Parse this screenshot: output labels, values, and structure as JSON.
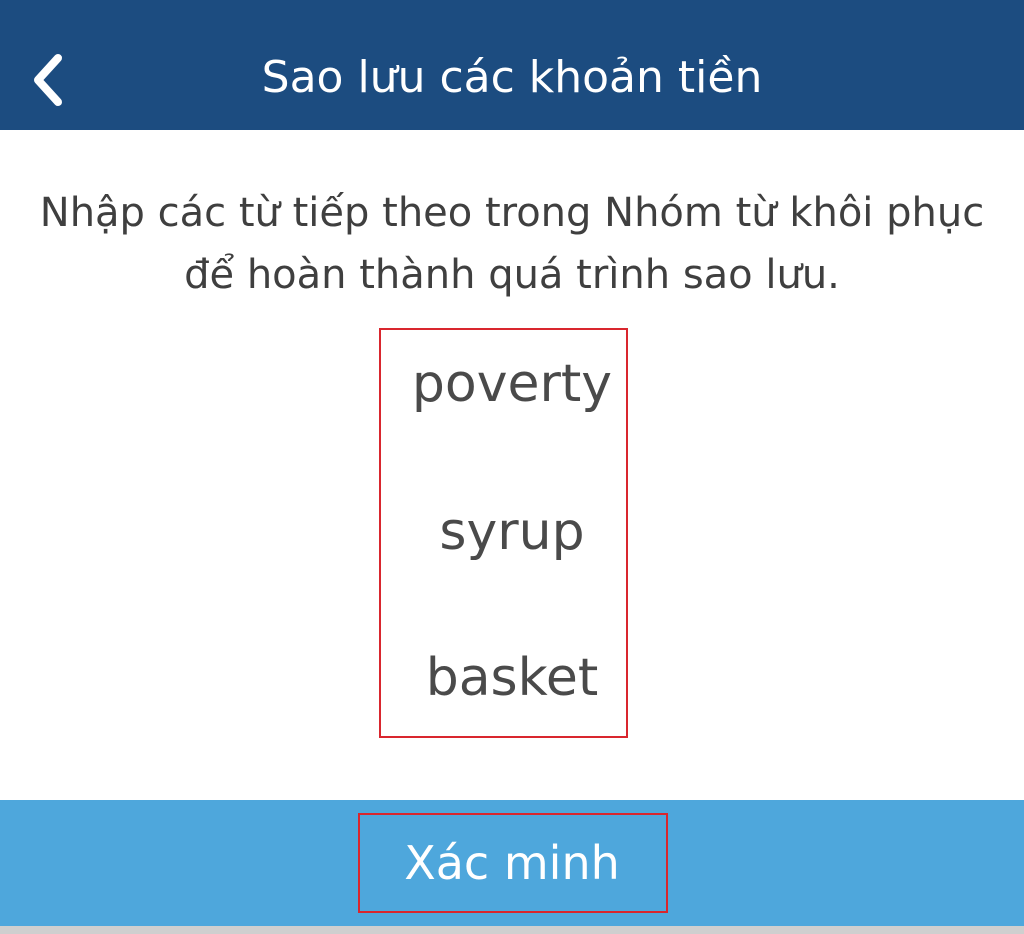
{
  "header": {
    "title": "Sao lưu các khoản tiền",
    "back_icon": "chevron-left-icon",
    "background": "#1c4c80"
  },
  "instruction": "Nhập các từ tiếp theo trong Nhóm từ khôi phục để hoàn thành quá trình sao lưu.",
  "words": [
    "poverty",
    "syrup",
    "basket"
  ],
  "footer": {
    "verify_label": "Xác minh",
    "background": "#4ea7dc"
  },
  "highlight_color": "#d9262e"
}
